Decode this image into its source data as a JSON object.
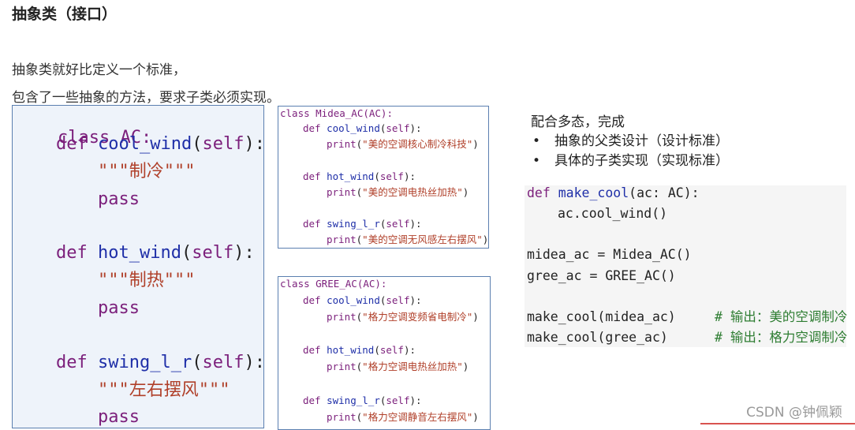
{
  "heading": "抽象类（接口）",
  "paragraphs": [
    "抽象类就好比定义一个标准，",
    "包含了一些抽象的方法，要求子类必须实现。"
  ],
  "main_code": {
    "class_line": "class AC:",
    "methods": [
      {
        "def": "def",
        "name": "cool_wind",
        "self": "self",
        "doc": "\"\"\"制冷\"\"\"",
        "body": "pass"
      },
      {
        "def": "def",
        "name": "hot_wind",
        "self": "self",
        "doc": "\"\"\"制热\"\"\"",
        "body": "pass"
      },
      {
        "def": "def",
        "name": "swing_l_r",
        "self": "self",
        "doc": "\"\"\"左右摆风\"\"\"",
        "body": "pass"
      }
    ]
  },
  "midea_code": {
    "class_line": "class Midea_AC(AC):",
    "methods": [
      {
        "name": "cool_wind",
        "print": "\"美的空调核心制冷科技\""
      },
      {
        "name": "hot_wind",
        "print": "\"美的空调电热丝加热\""
      },
      {
        "name": "swing_l_r",
        "print": "\"美的空调无风感左右摆风\""
      }
    ]
  },
  "gree_code": {
    "class_line": "class GREE_AC(AC):",
    "methods": [
      {
        "name": "cool_wind",
        "print": "\"格力空调变频省电制冷\""
      },
      {
        "name": "hot_wind",
        "print": "\"格力空调电热丝加热\""
      },
      {
        "name": "swing_l_r",
        "print": "\"格力空调静音左右摆风\""
      }
    ]
  },
  "note": {
    "title": "配合多态，完成",
    "bullets": [
      "抽象的父类设计（设计标准）",
      "具体的子类实现（实现标准）"
    ]
  },
  "usage_code": {
    "def_kw": "def",
    "def_name": "make_cool",
    "def_args": "(ac: AC):",
    "def_body": "ac.cool_wind()",
    "assign1": "midea_ac = Midea_AC()",
    "assign2": "gree_ac = GREE_AC()",
    "call1_fn": "make_cool",
    "call1_args": "(midea_ac)",
    "call1_comment": "# 输出：美的空调制冷",
    "call2_fn": "make_cool",
    "call2_args": "(gree_ac)",
    "call2_comment": "# 输出：格力空调制冷"
  },
  "watermark": "CSDN @钟佩颖"
}
